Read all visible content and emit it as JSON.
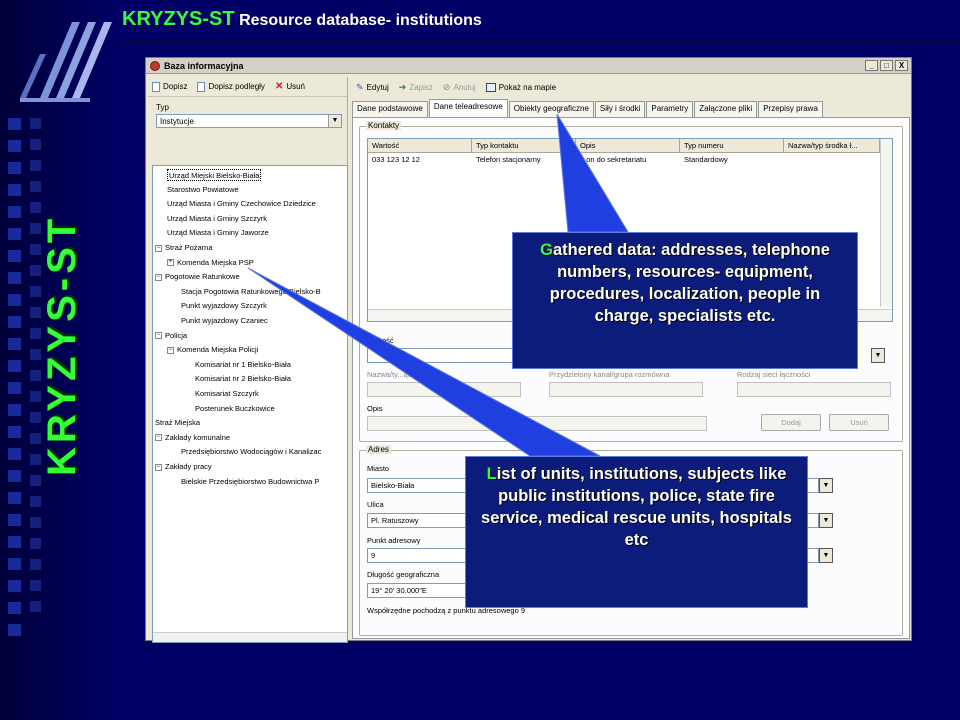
{
  "slide": {
    "brand": "KRYZYS-ST",
    "subtitle": "Resource database- institutions",
    "vertical_title": "KRYZYS-ST"
  },
  "window": {
    "title": "Baza informacyjna",
    "controls": [
      "_",
      "□",
      "X"
    ],
    "left_toolbar": [
      {
        "label": "Dopisz",
        "icon": "new-document-icon"
      },
      {
        "label": "Dopisz podległy",
        "icon": "new-child-document-icon"
      },
      {
        "label": "Usuń",
        "icon": "delete-x-icon"
      }
    ],
    "right_toolbar": [
      {
        "label": "Edytuj",
        "icon": "edit-icon"
      },
      {
        "label": "Zapisz",
        "icon": "save-arrow-icon"
      },
      {
        "label": "Anuluj",
        "icon": "cancel-icon"
      },
      {
        "label": "Pokaż na mapie",
        "icon": "map-icon"
      }
    ],
    "type_label": "Typ",
    "type_value": "Instytucje",
    "tree": [
      {
        "label": "Urząd Miejski Bielsko-Biała",
        "level": 1,
        "expander": "",
        "selected": true
      },
      {
        "label": "Starostwo Powiatowe",
        "level": 1,
        "expander": ""
      },
      {
        "label": "Urząd Miasta i Gminy Czechowice Dziedzice",
        "level": 1,
        "expander": ""
      },
      {
        "label": "Urząd Miasta i Gminy Szczyrk",
        "level": 1,
        "expander": ""
      },
      {
        "label": "Urząd Miasta i Gminy Jaworze",
        "level": 1,
        "expander": ""
      },
      {
        "label": "Straż Pożarna",
        "level": 0,
        "expander": "−"
      },
      {
        "label": "Komenda Miejska PSP",
        "level": 1,
        "expander": "+"
      },
      {
        "label": "Pogotowie Ratunkowe",
        "level": 0,
        "expander": "−"
      },
      {
        "label": "Stacja Pogotowia Ratunkowego Bielsko-B",
        "level": 2,
        "expander": ""
      },
      {
        "label": "Punkt wyjazdowy Szczyrk",
        "level": 2,
        "expander": ""
      },
      {
        "label": "Punkt wyjazdowy Czaniec",
        "level": 2,
        "expander": ""
      },
      {
        "label": "Policja",
        "level": 0,
        "expander": "−"
      },
      {
        "label": "Komenda Miejska Policji",
        "level": 1,
        "expander": "−"
      },
      {
        "label": "Komisariat nr 1 Bielsko-Biała",
        "level": 3,
        "expander": ""
      },
      {
        "label": "Komisariat nr 2 Bielsko-Biała",
        "level": 3,
        "expander": ""
      },
      {
        "label": "Komisariat Szczyrk",
        "level": 3,
        "expander": ""
      },
      {
        "label": "Posterunek Buczkowice",
        "level": 3,
        "expander": ""
      },
      {
        "label": "Straż Miejska",
        "level": 0,
        "expander": ""
      },
      {
        "label": "Zakłady komunalne",
        "level": 0,
        "expander": "−"
      },
      {
        "label": "Przedsiębiorstwo Wodociągów i Kanalizac",
        "level": 2,
        "expander": ""
      },
      {
        "label": "Zakłady pracy",
        "level": 0,
        "expander": "−"
      },
      {
        "label": "Bielskie Przedsiębiorstwo Budownictwa P",
        "level": 2,
        "expander": ""
      }
    ],
    "tabs": [
      "Dane podstawowe",
      "Dane teleadresowe",
      "Obiekty geograficzne",
      "Siły i środki",
      "Parametry",
      "Załączone pliki",
      "Przepisy prawa"
    ],
    "active_tab": 1,
    "contacts": {
      "legend": "Kontakty",
      "columns": [
        "Wartość",
        "Typ kontaktu",
        "Opis",
        "Typ numeru",
        "Nazwa/typ środka ł..."
      ],
      "rows": [
        [
          "033 123 12 12",
          "Telefon stacjonarny",
          "...on do sekretariatu",
          "Standardowy",
          ""
        ]
      ],
      "value_label": "...artość",
      "channel_label": "Nazwa/ty...ączności",
      "group_label": "Przydzielony kanał/grupa rozmówna",
      "network_label": "Rodzaj sieci łączności",
      "desc_label": "Opis",
      "add_button": "Dodaj",
      "remove_button": "Usuń"
    },
    "address": {
      "legend": "Adres",
      "city_label": "Miasto",
      "city_value": "Bielsko-Biała",
      "street_label": "Ulica",
      "street_value": "Pl. Ratuszowy",
      "number_label": "Punkt adresowy",
      "number_value": "9",
      "lon_label": "Długość geograficzna",
      "lon_value": "19° 20' 30.000\"E",
      "note": "Współrzędne pochodzą z punktu adresowego 9"
    }
  },
  "callouts": {
    "top_first": "G",
    "top_rest": "athered data: addresses, telephone numbers, resources- equipment, procedures, localization, people in charge, specialists etc.",
    "bottom_first": "L",
    "bottom_rest": "ist of units, institutions, subjects like public institutions, police, state fire service, medical rescue units, hospitals etc"
  },
  "colors": {
    "background": "#000066",
    "brand_green": "#33ff33",
    "callout_fill": "#0b1c7a",
    "pointer_blue": "#1f3fe0"
  }
}
